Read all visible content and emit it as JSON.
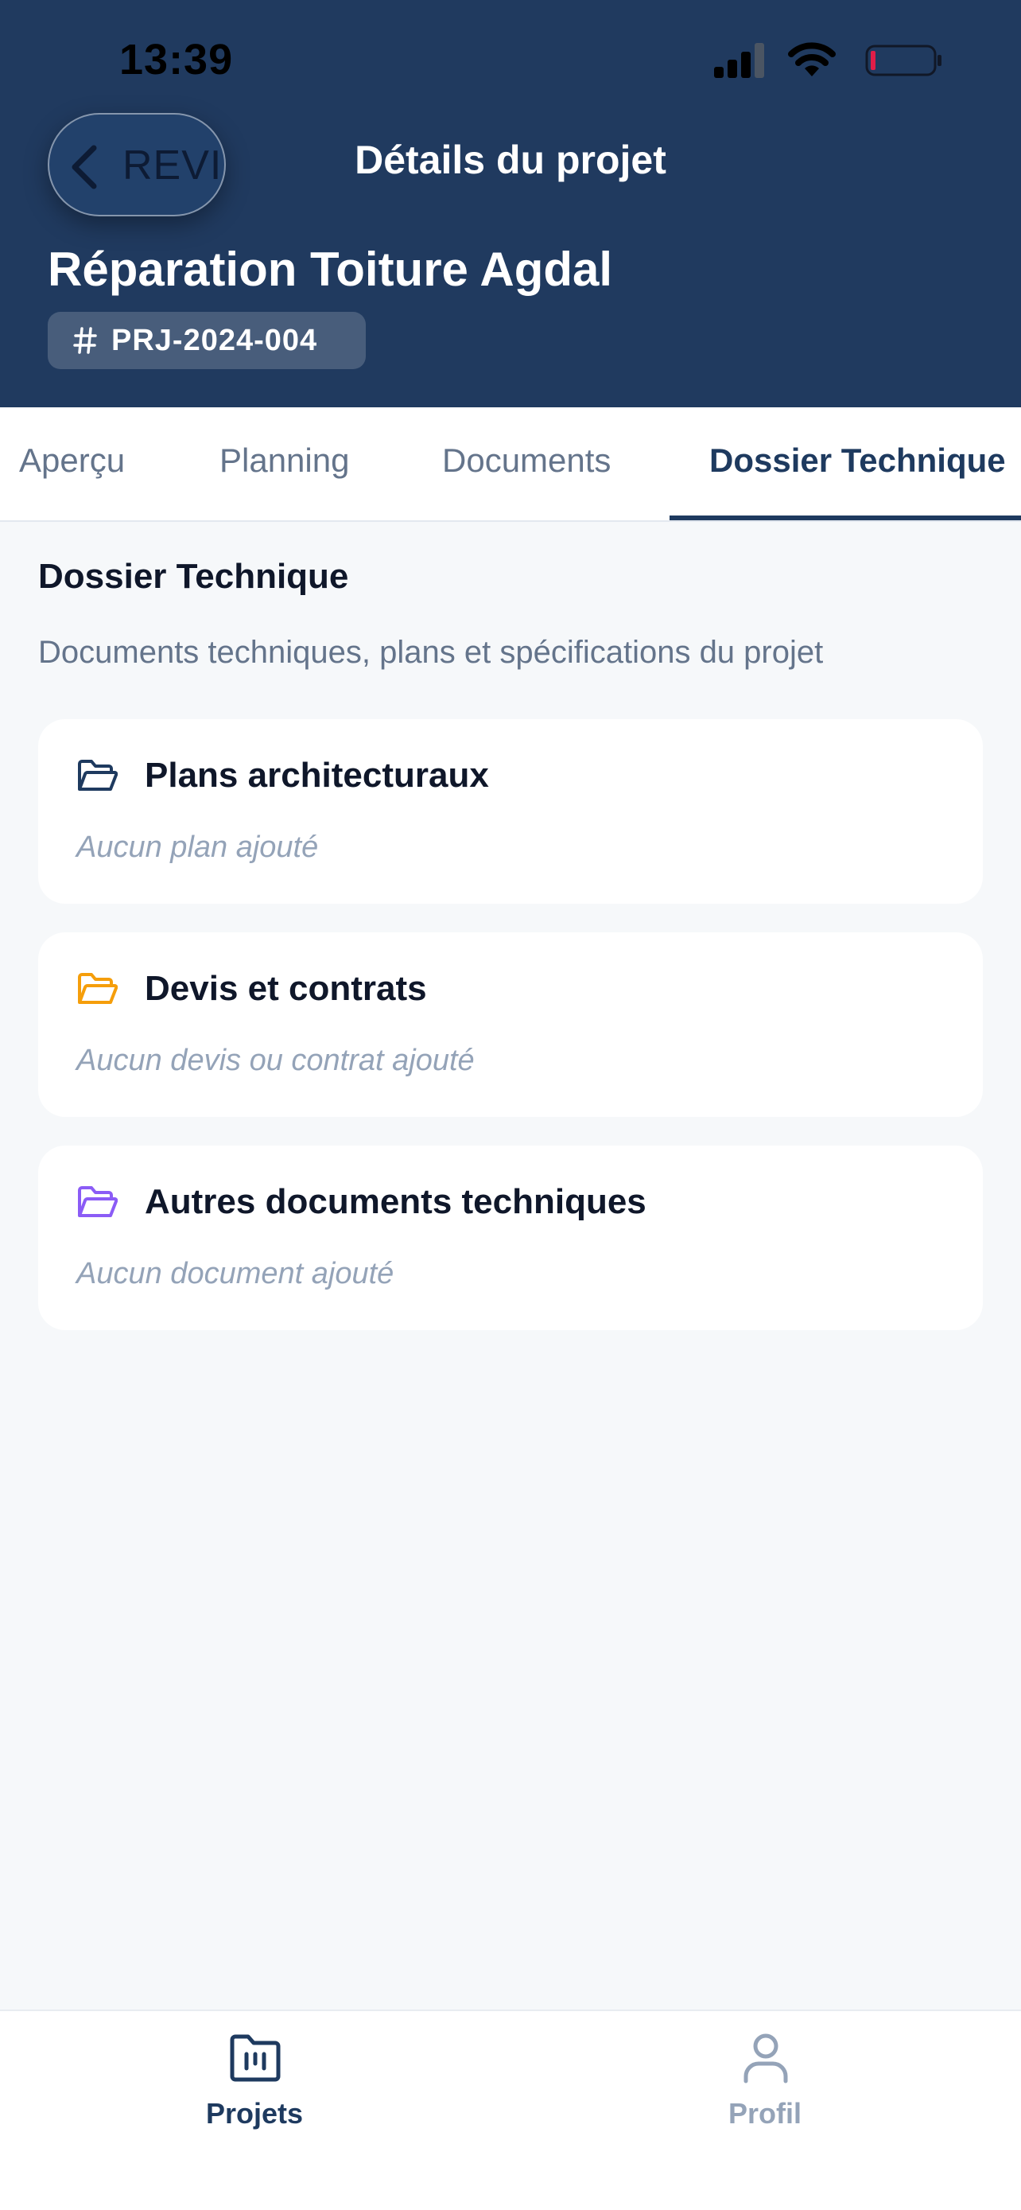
{
  "status_bar": {
    "time": "13:39"
  },
  "header": {
    "back_label": "REVI",
    "title": "Détails du projet",
    "project_name": "Réparation Toiture Agdal",
    "project_code": "PRJ-2024-004"
  },
  "tabs": [
    {
      "label": "Aperçu",
      "active": false
    },
    {
      "label": "Planning",
      "active": false
    },
    {
      "label": "Documents",
      "active": false
    },
    {
      "label": "Dossier Technique",
      "active": true
    }
  ],
  "section": {
    "title": "Dossier Technique",
    "description": "Documents techniques, plans et spécifications du projet"
  },
  "cards": [
    {
      "title": "Plans architecturaux",
      "empty_text": "Aucun plan ajouté",
      "icon": "folder-open-icon",
      "icon_color": "#1e3a5f"
    },
    {
      "title": "Devis et contrats",
      "empty_text": "Aucun devis ou contrat ajouté",
      "icon": "folder-open-icon",
      "icon_color": "#f59e0b"
    },
    {
      "title": "Autres documents techniques",
      "empty_text": "Aucun document ajouté",
      "icon": "folder-open-icon",
      "icon_color": "#8b5cf6"
    }
  ],
  "bottom_nav": [
    {
      "label": "Projets",
      "icon": "projects-folder-icon",
      "active": true
    },
    {
      "label": "Profil",
      "icon": "person-icon",
      "active": false
    }
  ],
  "colors": {
    "header_bg": "#203a5f",
    "accent": "#1e3a5f",
    "muted": "#64748b",
    "placeholder": "#94a3b8",
    "battery_low": "#e11d48"
  }
}
